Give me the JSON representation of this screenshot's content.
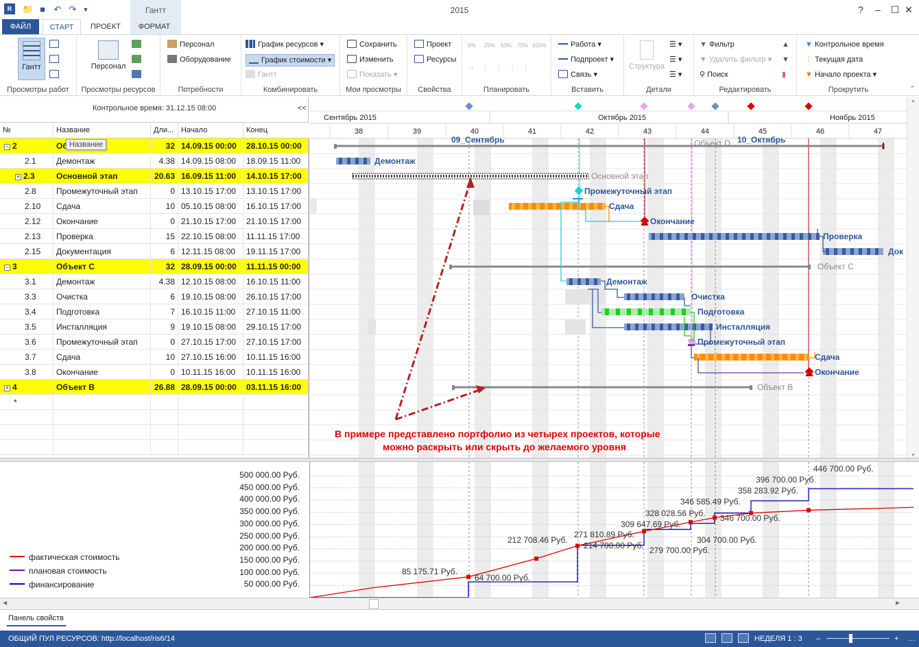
{
  "window": {
    "title": "2015",
    "context_tab": "Гантт"
  },
  "tabs": [
    "ФАЙЛ",
    "СТАРТ",
    "ПРОЕКТ",
    "ФОРМАТ"
  ],
  "ribbon": {
    "groups": [
      "Просмотры работ",
      "Просмотры ресурсов",
      "Потребности",
      "Комбинировать",
      "Мои просмотры",
      "Свойства",
      "Планировать",
      "Вставить",
      "Детали",
      "Редактировать",
      "Прокрутить"
    ],
    "gantt": "Гантт",
    "personnel_big": "Персонал",
    "personnel": "Персонал",
    "equipment": "Оборудование",
    "resource_chart": "График ресурсов",
    "cost_chart": "График стоимости",
    "gantt_small": "Гантт",
    "save": "Сохранить",
    "edit": "Изменить",
    "show": "Показать",
    "project": "Проект",
    "resources": "Ресурсы",
    "plan_pct": [
      "0%",
      "25%",
      "50%",
      "75%",
      "100%"
    ],
    "work": "Работа",
    "subproject": "Подпроект",
    "link": "Связь",
    "structure": "Структура",
    "filter": "Фильтр",
    "remove_filter": "Удалить фильтр",
    "search": "Поиск",
    "baseline_time": "Контрольное время",
    "current_date": "Текущая дата",
    "project_start": "Начало проекта"
  },
  "status_time": "Контрольное время: 31.12.15 08:00",
  "collapse": "<<",
  "columns": [
    "№",
    "Название",
    "Дли...",
    "Начало",
    "Конец"
  ],
  "tooltip": "Название",
  "rows": [
    {
      "id": "2",
      "name": "Объект D",
      "dur": "32",
      "start": "14.09.15 00:00",
      "end": "28.10.15 00:00",
      "summary": true,
      "exp": "⊟"
    },
    {
      "id": "2.1",
      "name": "Демонтаж",
      "dur": "4.38",
      "start": "14.09.15 08:00",
      "end": "18.09.15 11:00"
    },
    {
      "id": "2.3",
      "name": "Основной этап",
      "dur": "20.63",
      "start": "16.09.15 11:00",
      "end": "14.10.15 17:00",
      "summary": true,
      "exp": "⊞",
      "indent": true
    },
    {
      "id": "2.8",
      "name": "Промежуточный этап",
      "dur": "0",
      "start": "13.10.15 17:00",
      "end": "13.10.15 17:00"
    },
    {
      "id": "2.10",
      "name": "Сдача",
      "dur": "10",
      "start": "05.10.15 08:00",
      "end": "16.10.15 17:00"
    },
    {
      "id": "2.12",
      "name": "Окончание",
      "dur": "0",
      "start": "21.10.15 17:00",
      "end": "21.10.15 17:00"
    },
    {
      "id": "2.13",
      "name": "Проверка",
      "dur": "15",
      "start": "22.10.15 08:00",
      "end": "11.11.15 17:00"
    },
    {
      "id": "2.15",
      "name": "Документация",
      "dur": "6",
      "start": "12.11.15 08:00",
      "end": "19.11.15 17:00"
    },
    {
      "id": "3",
      "name": "Объект C",
      "dur": "32",
      "start": "28.09.15 00:00",
      "end": "11.11.15 00:00",
      "summary": true,
      "exp": "⊟"
    },
    {
      "id": "3.1",
      "name": "Демонтаж",
      "dur": "4.38",
      "start": "12.10.15 08:00",
      "end": "16.10.15 11:00"
    },
    {
      "id": "3.3",
      "name": "Очистка",
      "dur": "6",
      "start": "19.10.15 08:00",
      "end": "26.10.15 17:00"
    },
    {
      "id": "3.4",
      "name": "Подготовка",
      "dur": "7",
      "start": "16.10.15 11:00",
      "end": "27.10.15 11:00"
    },
    {
      "id": "3.5",
      "name": "Инсталляция",
      "dur": "9",
      "start": "19.10.15 08:00",
      "end": "29.10.15 17:00"
    },
    {
      "id": "3.6",
      "name": "Промежуточный этап",
      "dur": "0",
      "start": "27.10.15 17:00",
      "end": "27.10.15 17:00"
    },
    {
      "id": "3.7",
      "name": "Сдача",
      "dur": "10",
      "start": "27.10.15 16:00",
      "end": "10.11.15 16:00"
    },
    {
      "id": "3.8",
      "name": "Окончание",
      "dur": "0",
      "start": "10.11.15 16:00",
      "end": "10.11.15 16:00"
    },
    {
      "id": "4",
      "name": "Объект В",
      "dur": "26.88",
      "start": "28.09.15 00:00",
      "end": "03.11.15 16:00",
      "summary": true,
      "exp": "⊞"
    },
    {
      "id": "*",
      "name": "",
      "dur": "",
      "start": "",
      "end": ""
    }
  ],
  "timescale": {
    "months": [
      "Сентябрь 2015",
      "Октябрь 2015",
      "Ноябрь 2015"
    ],
    "weeks": [
      "38",
      "39",
      "40",
      "41",
      "42",
      "43",
      "44",
      "45",
      "46",
      "47"
    ]
  },
  "gantt_labels": {
    "l0a": "09_Сентябрь",
    "l0b": "Объект D",
    "l0c": "10_Октябрь",
    "l1": "Демонтаж",
    "l2": "Основной этап",
    "l3": "Промежуточный этап",
    "l4": "Сдача",
    "l5": "Окончание",
    "l6": "Проверка",
    "l7": "Док",
    "l8": "Объект C",
    "l9": "Демонтаж",
    "l10": "Очистка",
    "l11": "Подготовка",
    "l12": "Инсталляция",
    "l13": "Промежуточный этап",
    "l14": "Сдача",
    "l15": "Окончание",
    "l16": "Объект В"
  },
  "annotation": [
    "В примере представлено портфолио из четырех проектов, которые",
    "можно раскрыть или скрыть до желаемого уровня"
  ],
  "chart_data": {
    "type": "line",
    "title": "",
    "x_weeks": [
      "38",
      "39",
      "40",
      "41",
      "42",
      "43",
      "44",
      "45",
      "46",
      "47"
    ],
    "ylim": [
      0,
      500000
    ],
    "y_ticks": [
      "500 000.00 Руб.",
      "450 000.00 Руб.",
      "400 000.00 Руб.",
      "350 000.00 Руб.",
      "300 000.00 Руб.",
      "250 000.00 Руб.",
      "200 000.00 Руб.",
      "150 000.00 Руб.",
      "100 000.00 Руб.",
      "50 000.00 Руб."
    ],
    "series": [
      {
        "name": "фактическая стоимость",
        "color": "#e00000"
      },
      {
        "name": "плановая стоимость",
        "color": "#6a0dad"
      },
      {
        "name": "финансирование",
        "color": "#0000cc"
      }
    ],
    "data_labels": [
      "85 175.71 Руб.",
      "64 700.00 Руб.",
      "212 708.46 Руб.",
      "271 810.89 Руб.",
      "214 700.00 Руб.",
      "309 647.69 Руб.",
      "328 028.56 Руб.",
      "279 700.00 Руб.",
      "346 585.49 Руб.",
      "304 700.00 Руб.",
      "358 283.92 Руб.",
      "346 700.00 Руб.",
      "396 700.00 Руб.",
      "446 700.00 Руб."
    ],
    "step_points": [
      [
        0,
        0
      ],
      [
        231,
        0
      ],
      [
        231,
        64700
      ],
      [
        390,
        64700
      ],
      [
        390,
        214700
      ],
      [
        487,
        214700
      ],
      [
        487,
        279700
      ],
      [
        555,
        279700
      ],
      [
        555,
        304700
      ],
      [
        590,
        304700
      ],
      [
        590,
        346700
      ],
      [
        643,
        346700
      ],
      [
        643,
        396700
      ],
      [
        727,
        396700
      ],
      [
        727,
        446700
      ],
      [
        880,
        446700
      ]
    ],
    "actual_points": [
      [
        0,
        0
      ],
      [
        90,
        40000
      ],
      [
        231,
        85175
      ],
      [
        330,
        160000
      ],
      [
        390,
        212708
      ],
      [
        487,
        271810
      ],
      [
        555,
        309647
      ],
      [
        590,
        328028
      ],
      [
        643,
        346585
      ],
      [
        727,
        358283
      ],
      [
        880,
        370000
      ]
    ]
  },
  "panel": "Панель свойств",
  "statusbar": {
    "pool": "ОБЩИЙ ПУЛ РЕСУРСОВ: http://localhost/ris6/14",
    "zoom": "НЕДЕЛЯ 1 : 3"
  },
  "colors": {
    "accent": "#2b579a",
    "summary_row": "#ffff00",
    "task_bar": "#5b7fbf",
    "orange": "#ff8c00",
    "green": "#22cc22"
  }
}
